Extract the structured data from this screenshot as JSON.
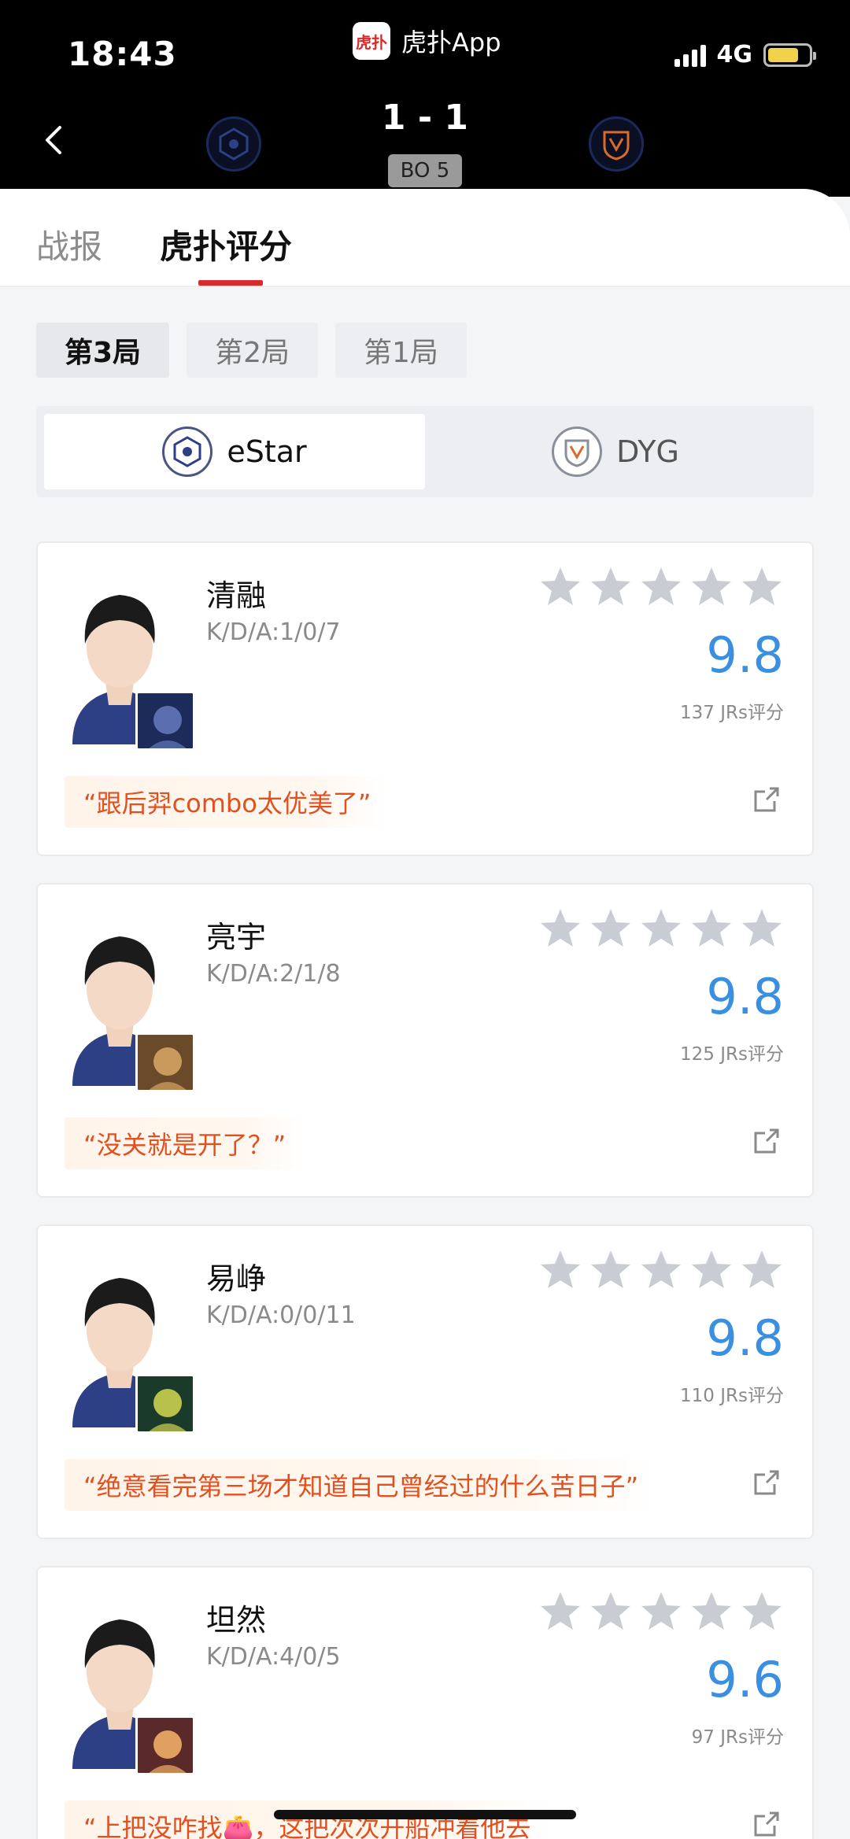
{
  "status_bar": {
    "time": "18:43",
    "app_name": "虎扑App",
    "app_logo_text": "虎扑",
    "network": "4G",
    "battery_level": 0.75
  },
  "match": {
    "score": "1 - 1",
    "format": "BO 5"
  },
  "tabs": [
    {
      "label": "战报",
      "active": false
    },
    {
      "label": "虎扑评分",
      "active": true
    }
  ],
  "games": [
    {
      "label": "第3局",
      "active": true
    },
    {
      "label": "第2局",
      "active": false
    },
    {
      "label": "第1局",
      "active": false
    }
  ],
  "teams": [
    {
      "name": "eStar",
      "active": true
    },
    {
      "name": "DYG",
      "active": false
    }
  ],
  "players": [
    {
      "name": "清融",
      "kda": "K/D/A:1/0/7",
      "rating": "9.8",
      "votes": "137 JRs评分",
      "quote": "“跟后羿combo太优美了”",
      "stars": 5
    },
    {
      "name": "亮宇",
      "kda": "K/D/A:2/1/8",
      "rating": "9.8",
      "votes": "125 JRs评分",
      "quote": "“没关就是开了？”",
      "stars": 5
    },
    {
      "name": "易峥",
      "kda": "K/D/A:0/0/11",
      "rating": "9.8",
      "votes": "110 JRs评分",
      "quote": "“绝意看完第三场才知道自己曾经过的什么苦日子”",
      "stars": 5
    },
    {
      "name": "坦然",
      "kda": "K/D/A:4/0/5",
      "rating": "9.6",
      "votes": "97 JRs评分",
      "quote": "“上把没咋找👛，这把次次开船冲着他去",
      "stars": 5
    }
  ],
  "colors": {
    "accent_red": "#d92b2b",
    "rating_blue": "#3a8fe0",
    "quote_orange": "#e2501f",
    "star_gray": "#c9ccd3"
  }
}
